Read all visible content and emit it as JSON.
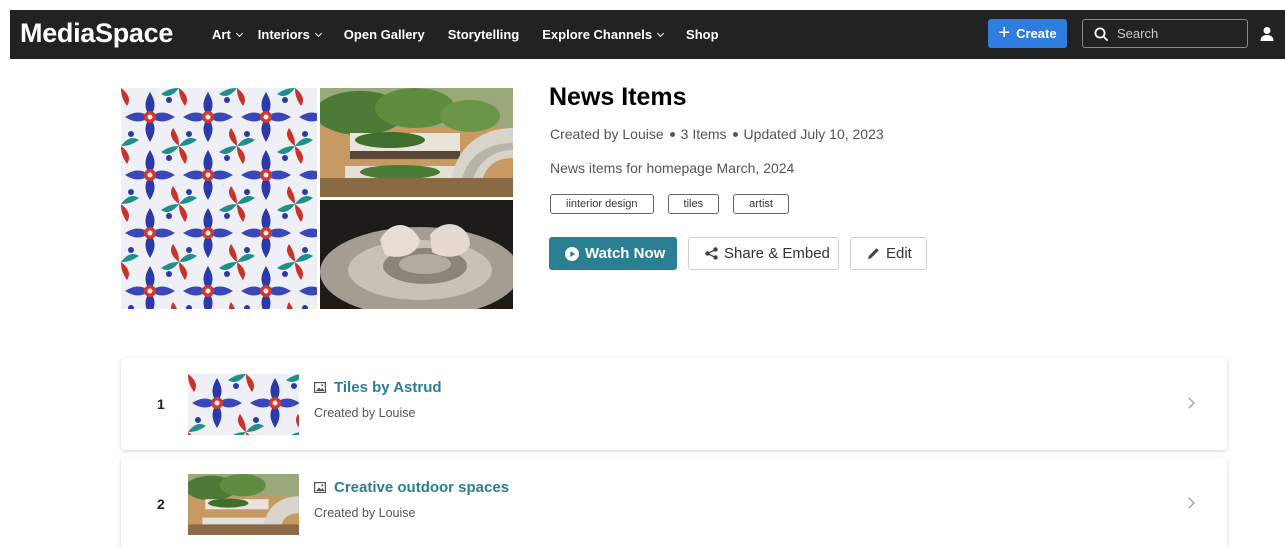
{
  "header": {
    "logo": "MediaSpace",
    "nav": [
      {
        "label": "Art",
        "has_dropdown": true
      },
      {
        "label": "Interiors",
        "has_dropdown": true
      },
      {
        "label": "Open Gallery",
        "has_dropdown": false
      },
      {
        "label": "Storytelling",
        "has_dropdown": false
      },
      {
        "label": "Explore Channels",
        "has_dropdown": true
      },
      {
        "label": "Shop",
        "has_dropdown": false
      }
    ],
    "create_label": "Create",
    "search_placeholder": "Search",
    "colors": {
      "bar": "#222222",
      "create": "#2f7de1"
    }
  },
  "playlist": {
    "title": "News Items",
    "meta": {
      "created_by": "Created by Louise",
      "item_count": "3 Items",
      "updated": "Updated July 10, 2023"
    },
    "description": "News items for homepage March, 2024",
    "tags": [
      "iinterior design",
      "tiles",
      "artist"
    ],
    "actions": {
      "watch": "Watch Now",
      "share": "Share & Embed",
      "edit": "Edit"
    },
    "accent": "#2b7f93"
  },
  "items": [
    {
      "index": "1",
      "title": "Tiles by Astrud",
      "subtitle": "Created by Louise",
      "type_icon": "image-icon"
    },
    {
      "index": "2",
      "title": "Creative outdoor spaces",
      "subtitle": "Created by Louise",
      "type_icon": "image-icon"
    }
  ]
}
